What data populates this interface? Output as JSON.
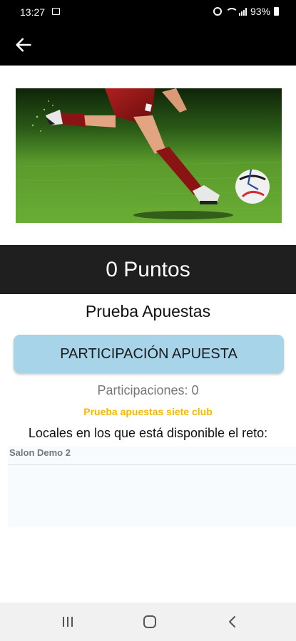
{
  "status_bar": {
    "time": "13:27",
    "battery": "93%",
    "icons": [
      "image-icon",
      "alarm-icon",
      "wifi-icon",
      "signal-icon",
      "battery-icon"
    ]
  },
  "app_bar": {
    "back_icon": "arrow-left-icon"
  },
  "hero": {
    "image": "football-player-kicking-ball"
  },
  "points": {
    "label": "0 Puntos"
  },
  "challenge": {
    "title": "Prueba Apuestas",
    "button_label": "PARTICIPACIÓN APUESTA",
    "participations": "Participaciones: 0",
    "club": "Prueba apuestas siete club",
    "venues_heading": "Locales en los que está disponible el reto:",
    "venues": [
      "Salon Demo 2"
    ]
  },
  "nav_bar": {
    "icons": [
      "recent-apps-icon",
      "home-icon",
      "back-icon"
    ]
  },
  "colors": {
    "button_bg": "#a8d4ea",
    "points_band": "#1f1f1f",
    "club_text": "#f5b800",
    "bars": "#000000"
  }
}
